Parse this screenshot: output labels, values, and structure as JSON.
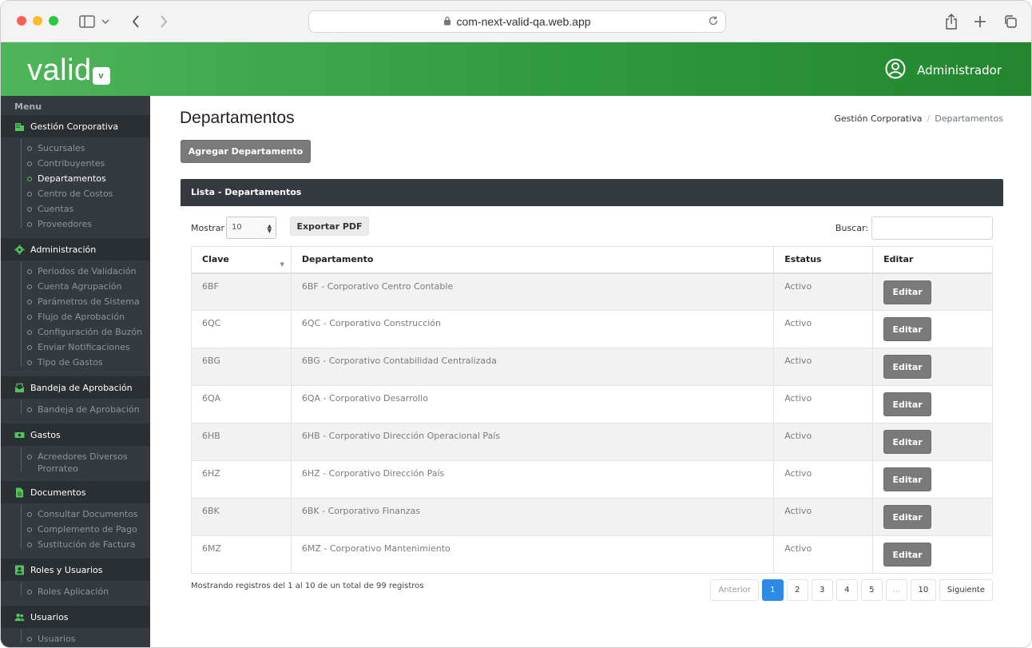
{
  "browser": {
    "url": "com-next-valid-qa.web.app"
  },
  "header": {
    "logo_text": "valid",
    "logo_badge": "v",
    "user_name": "Administrador"
  },
  "sidebar": {
    "menu_title": "Menu",
    "sections": [
      {
        "title": "Gestión Corporativa",
        "icon": "building-icon",
        "items": [
          "Sucursales",
          "Contribuyentes",
          "Departamentos",
          "Centro de Costos",
          "Cuentas",
          "Proveedores"
        ]
      },
      {
        "title": "Administración",
        "icon": "gear-icon",
        "items": [
          "Periodos de Validación",
          "Cuenta Agrupación",
          "Parámetros de Sistema",
          "Flujo de Aprobación",
          "Configuración de Buzón",
          "Enviar Notificaciones",
          "Tipo de Gastos"
        ]
      },
      {
        "title": "Bandeja de Aprobación",
        "icon": "inbox-icon",
        "items": [
          "Bandeja de Aprobación"
        ]
      },
      {
        "title": "Gastos",
        "icon": "money-icon",
        "items": [
          "Acreedores Diversos Prorrateo"
        ]
      },
      {
        "title": "Documentos",
        "icon": "document-icon",
        "items": [
          "Consultar Documentos",
          "Complemento de Pago",
          "Sustitución de Factura"
        ]
      },
      {
        "title": "Roles y Usuarios",
        "icon": "id-card-icon",
        "items": [
          "Roles Aplicación"
        ]
      },
      {
        "title": "Usuarios",
        "icon": "users-icon",
        "items": [
          "Usuarios"
        ]
      }
    ],
    "active_item": "Departamentos"
  },
  "main": {
    "title": "Departamentos",
    "breadcrumb": [
      "Gestión Corporativa",
      "Departamentos"
    ],
    "add_button": "Agregar Departamento",
    "card_title": "Lista - Departamentos",
    "show_label": "Mostrar",
    "page_size": "10",
    "export_button": "Exportar PDF",
    "search_label": "Buscar:",
    "search_value": "",
    "columns": [
      "Clave",
      "Departamento",
      "Estatus",
      "Editar"
    ],
    "rows": [
      {
        "clave": "6BF",
        "departamento": "6BF - Corporativo Centro Contable",
        "estatus": "Activo",
        "editar": "Editar"
      },
      {
        "clave": "6QC",
        "departamento": "6QC - Corporativo Construcción",
        "estatus": "Activo",
        "editar": "Editar"
      },
      {
        "clave": "6BG",
        "departamento": "6BG - Corporativo Contabilidad Centralizada",
        "estatus": "Activo",
        "editar": "Editar"
      },
      {
        "clave": "6QA",
        "departamento": "6QA - Corporativo Desarrollo",
        "estatus": "Activo",
        "editar": "Editar"
      },
      {
        "clave": "6HB",
        "departamento": "6HB - Corporativo Dirección Operacional País",
        "estatus": "Activo",
        "editar": "Editar"
      },
      {
        "clave": "6HZ",
        "departamento": "6HZ - Corporativo Dirección País",
        "estatus": "Activo",
        "editar": "Editar"
      },
      {
        "clave": "6BK",
        "departamento": "6BK - Corporativo Finanzas",
        "estatus": "Activo",
        "editar": "Editar"
      },
      {
        "clave": "6MZ",
        "departamento": "6MZ - Corporativo Mantenimiento",
        "estatus": "Activo",
        "editar": "Editar"
      }
    ],
    "footer_info": "Mostrando registros del 1 al 10 de un total de 99 registros",
    "pagination": {
      "prev": "Anterior",
      "pages": [
        "1",
        "2",
        "3",
        "4",
        "5",
        "...",
        "10"
      ],
      "active_page": "1",
      "next": "Siguiente"
    }
  },
  "colors": {
    "brand_green": "#2f9a3c",
    "sidebar_bg": "#343a40",
    "active_page": "#2e8ae6",
    "button_gray": "#7a7a7a"
  }
}
